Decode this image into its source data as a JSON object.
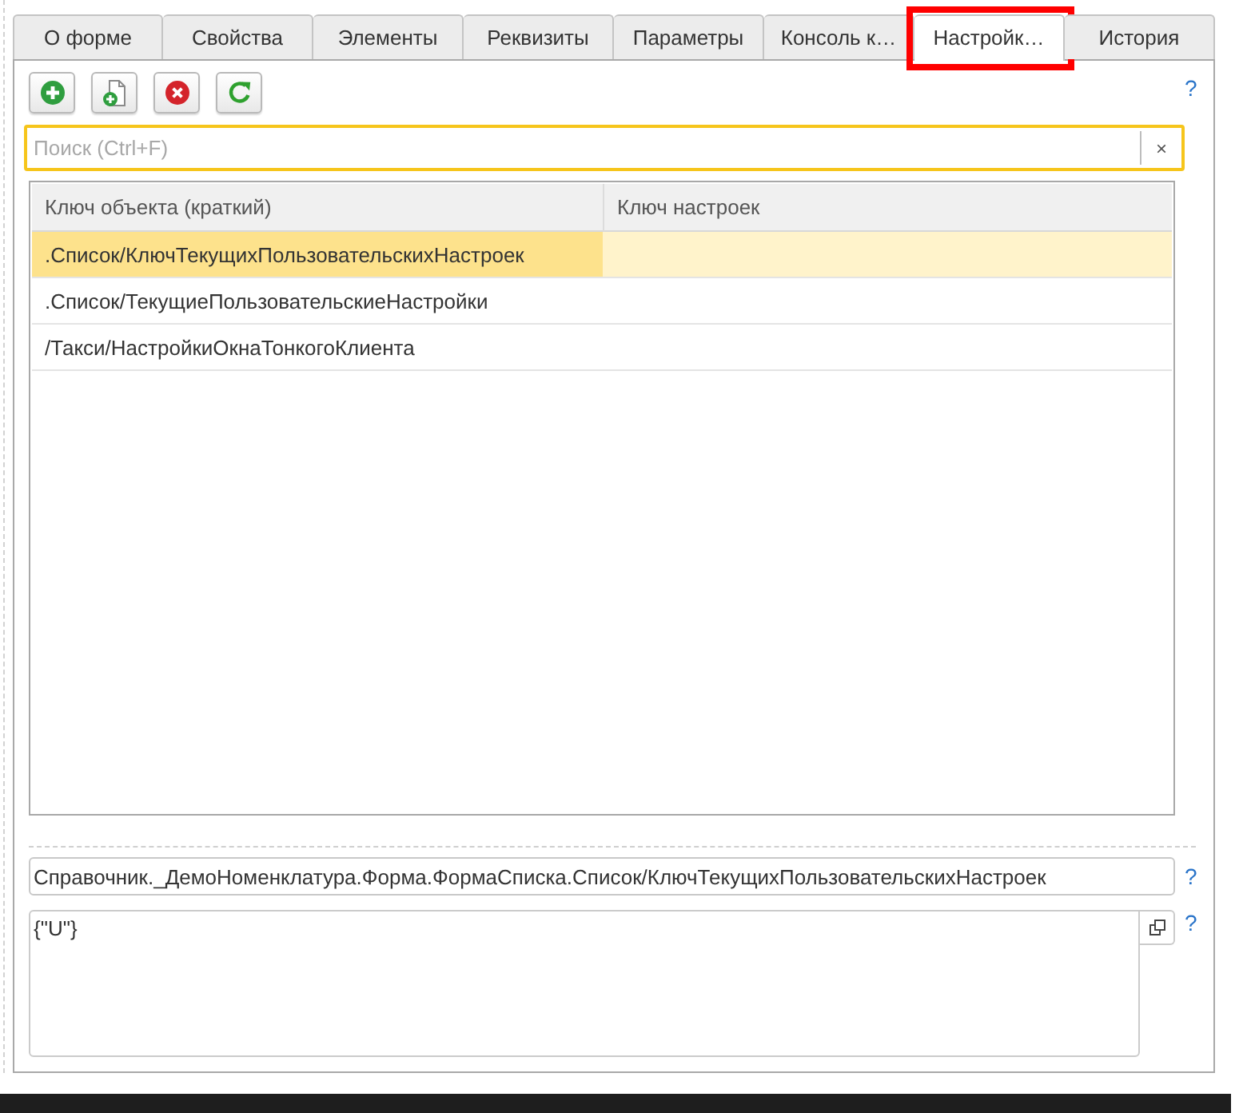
{
  "tabs": [
    {
      "label": "О форме",
      "selected": false,
      "highlighted": false
    },
    {
      "label": "Свойства",
      "selected": false,
      "highlighted": false
    },
    {
      "label": "Элементы",
      "selected": false,
      "highlighted": false
    },
    {
      "label": "Реквизиты",
      "selected": false,
      "highlighted": false
    },
    {
      "label": "Параметры",
      "selected": false,
      "highlighted": false
    },
    {
      "label": "Консоль к…",
      "selected": false,
      "highlighted": false
    },
    {
      "label": "Настройк…",
      "selected": true,
      "highlighted": true
    },
    {
      "label": "История",
      "selected": false,
      "highlighted": false
    }
  ],
  "toolbar": {
    "buttons": [
      {
        "kind": "add"
      },
      {
        "kind": "copy"
      },
      {
        "kind": "delete"
      },
      {
        "kind": "refresh"
      }
    ],
    "help": "?"
  },
  "search": {
    "placeholder": "Поиск (Ctrl+F)",
    "clear": "×",
    "focused": true
  },
  "table": {
    "columns": [
      "Ключ объекта (краткий)",
      "Ключ настроек"
    ],
    "rows": [
      {
        "object_key": ".Список/КлючТекущихПользовательскихНастроек",
        "selected": true
      },
      {
        "object_key": ".Список/ТекущиеПользовательскиеНастройки",
        "selected": false
      },
      {
        "object_key": "/Такси/НастройкиОкнаТонкогоКлиента",
        "selected": false
      }
    ]
  },
  "settings_key": {
    "value": "Справочник._ДемоНоменклатура.Форма.ФормаСписка.Список/КлючТекущихПользовательскихНастроек",
    "help": "?"
  },
  "settings_value": {
    "value": "{\"U\"}",
    "help": "?"
  }
}
